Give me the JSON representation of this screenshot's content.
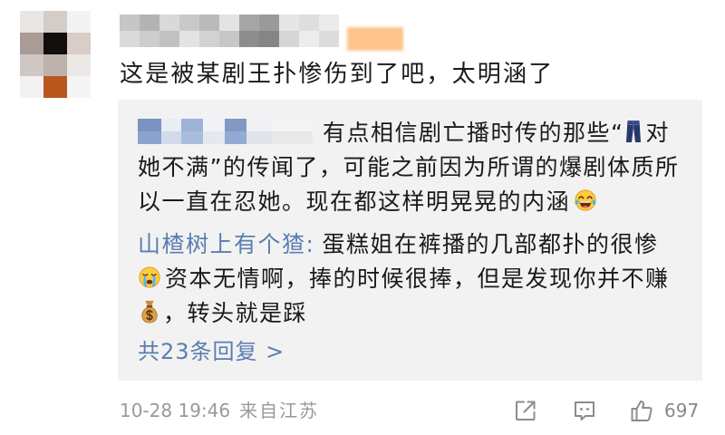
{
  "comment": {
    "text": "这是被某剧王扑惨伤到了吧，太明涵了",
    "time": "10-28 19:46",
    "source": "来自江苏"
  },
  "replies": [
    {
      "lines": [
        {
          "text": "有点相信剧亡播时传的那些“",
          "icon": "jeans-icon",
          "tail": "对"
        },
        {
          "text": "她不满”的传闻了，可能之前因为所谓的爆剧体质所"
        },
        {
          "text": "以一直在忍她。现在都这样明晃晃的内涵",
          "icon": "laughing-tears-icon"
        }
      ]
    },
    {
      "author": "山楂树上有个猹:",
      "lines": [
        {
          "text": "蛋糕姐在裤播的几部都扑的很惨"
        },
        {
          "icon": "crying-face-icon",
          "text": "资本无情啊，捧的时候很捧，但是发现你并不赚"
        },
        {
          "icon": "money-bag-icon",
          "text": "，转头就是踩"
        }
      ]
    }
  ],
  "more_replies_label": "共23条回复 >",
  "actions": {
    "share_icon": "share-icon",
    "comment_icon": "comment-icon",
    "like_icon": "like-icon",
    "like_count": "697"
  },
  "colors": {
    "text": "#1a1a1a",
    "link_blue": "#5b7db1",
    "meta_gray": "#999999",
    "reply_box_bg": "#f2f2f2",
    "icon_gray": "#8c8c8c"
  }
}
